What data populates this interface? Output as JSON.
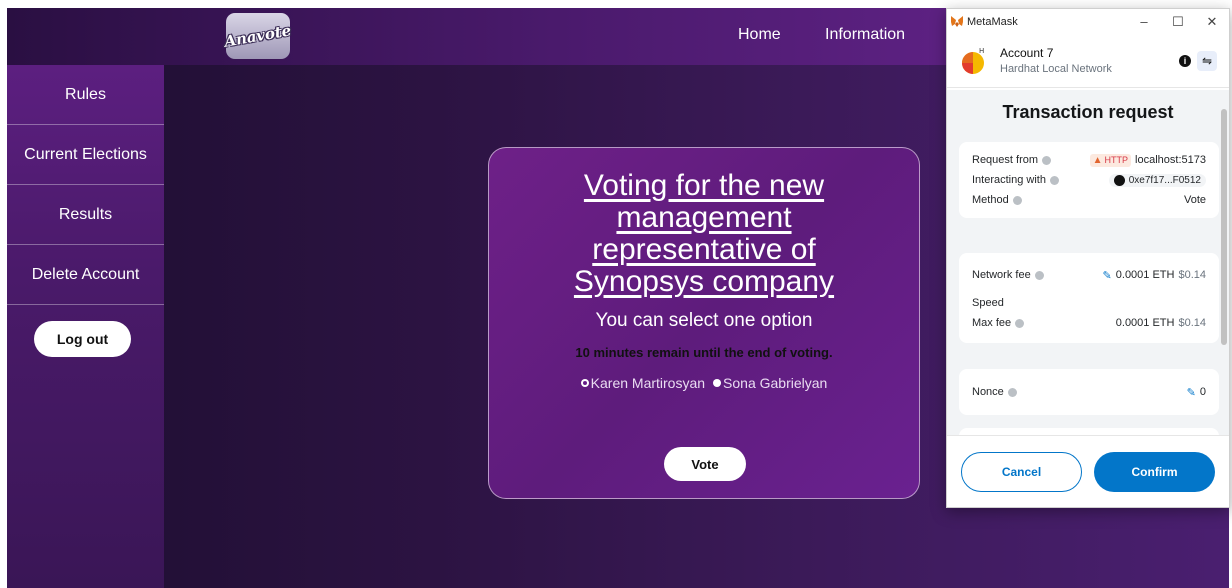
{
  "app": {
    "logo_text": "Anavote",
    "nav": {
      "home": "Home",
      "information": "Information"
    },
    "sidebar": {
      "items": [
        {
          "label": "Rules"
        },
        {
          "label": "Current Elections"
        },
        {
          "label": "Results"
        },
        {
          "label": "Delete Account"
        }
      ],
      "logout_label": "Log out"
    },
    "vote": {
      "title": "Voting for the new management representative of Synopsys company",
      "subtitle": "You can select one option",
      "timer": "10 minutes remain until the end of voting.",
      "options": [
        {
          "label": "Karen Martirosyan",
          "selected": true
        },
        {
          "label": "Sona Gabrielyan",
          "selected": false
        }
      ],
      "button_label": "Vote"
    },
    "colors": {
      "sidebar": "#5c1f80",
      "card": "#6e2088",
      "navbar": "#4a1a6c"
    }
  },
  "metamask": {
    "window_title": "MetaMask",
    "account_name": "Account 7",
    "network": "Hardhat Local Network",
    "heading": "Transaction request",
    "request_from_label": "Request from",
    "http_badge": "HTTP",
    "request_from_value": "localhost:5173",
    "interacting_label": "Interacting with",
    "interacting_value": "0xe7f17...F0512",
    "method_label": "Method",
    "method_value": "Vote",
    "network_fee_label": "Network fee",
    "network_fee_eth": "0.0001 ETH",
    "network_fee_usd": "$0.14",
    "speed_label": "Speed",
    "max_fee_label": "Max fee",
    "max_fee_eth": "0.0001 ETH",
    "max_fee_usd": "$0.14",
    "nonce_label": "Nonce",
    "nonce_value": "0",
    "cancel_label": "Cancel",
    "confirm_label": "Confirm",
    "colors": {
      "primary": "#0376c9",
      "body_bg": "#f2f4f6"
    }
  }
}
